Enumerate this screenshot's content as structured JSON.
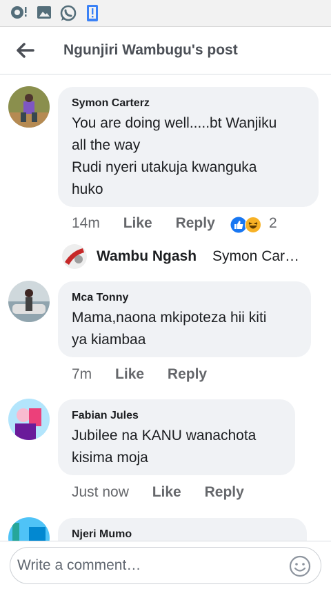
{
  "status_bar": {
    "icons": [
      "cast-icon",
      "gallery-icon",
      "whatsapp-icon",
      "phone-alert-icon"
    ]
  },
  "header": {
    "title": "Ngunjiri Wambugu's post",
    "back_icon": "back-arrow-icon"
  },
  "comments": [
    {
      "author": "Symon Carterz",
      "text_lines": [
        "You are doing well.....bt Wanjiku",
        "all the way",
        "Rudi nyeri utakuja kwanguka",
        "huko"
      ],
      "time": "14m",
      "like_label": "Like",
      "reply_label": "Reply",
      "reactions": [
        "like-reaction-icon",
        "haha-reaction-icon"
      ],
      "reaction_count": "2"
    },
    {
      "author": "Mca Tonny",
      "text_lines": [
        "Mama,naona mkipoteza hii kiti",
        "ya kiambaa"
      ],
      "time": "7m",
      "like_label": "Like",
      "reply_label": "Reply"
    },
    {
      "author": "Fabian Jules",
      "text_lines": [
        "Jubilee na KANU wanachota",
        "kisima moja"
      ],
      "time": "Just now",
      "like_label": "Like",
      "reply_label": "Reply"
    },
    {
      "author": "Njeri Mumo"
    }
  ],
  "reply_preview": {
    "author": "Wambu Ngash",
    "text": "Symon Car…"
  },
  "composer": {
    "placeholder": "Write a comment…",
    "emoji_icon": "emoji-smile-icon"
  },
  "colors": {
    "bubble": "#f0f2f5",
    "like_blue": "#1877f2",
    "haha_yellow": "#f7b125",
    "meta_grey": "#65676b"
  }
}
